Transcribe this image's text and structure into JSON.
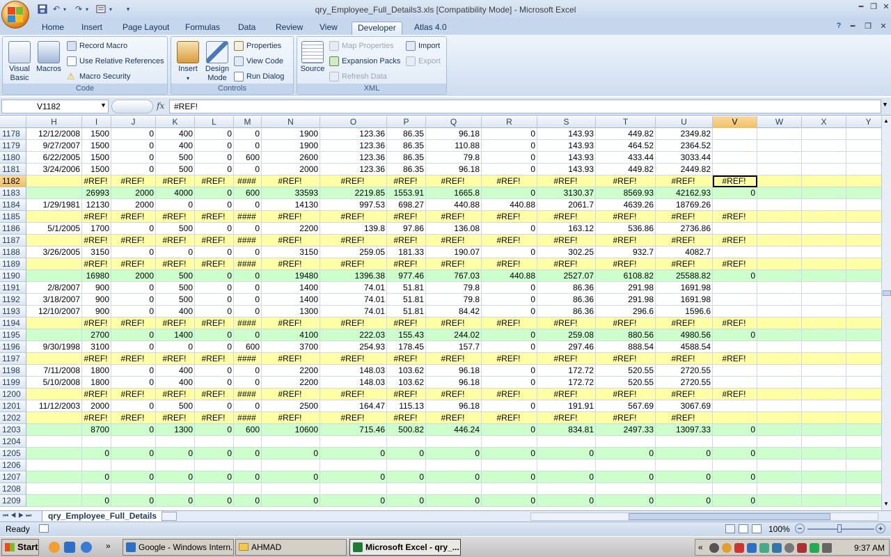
{
  "window": {
    "title": "qry_Employee_Full_Details3.xls  [Compatibility Mode] - Microsoft Excel"
  },
  "ribbon_tabs": [
    "Home",
    "Insert",
    "Page Layout",
    "Formulas",
    "Data",
    "Review",
    "View",
    "Developer",
    "Atlas 4.0"
  ],
  "active_tab": "Developer",
  "groups": {
    "code": {
      "title": "Code",
      "visual_basic": "Visual\nBasic",
      "macros": "Macros",
      "record_macro": "Record Macro",
      "relative_refs": "Use Relative References",
      "macro_security": "Macro Security"
    },
    "controls": {
      "title": "Controls",
      "insert": "Insert",
      "design_mode": "Design\nMode",
      "properties": "Properties",
      "view_code": "View Code",
      "run_dialog": "Run Dialog"
    },
    "xml": {
      "title": "XML",
      "source": "Source",
      "map_properties": "Map Properties",
      "expansion_packs": "Expansion Packs",
      "refresh_data": "Refresh Data",
      "import": "Import",
      "export": "Export"
    }
  },
  "formula_bar": {
    "name_box": "V1182",
    "fx": "fx",
    "formula": "#REF!"
  },
  "columns": [
    "H",
    "I",
    "J",
    "K",
    "L",
    "M",
    "N",
    "O",
    "P",
    "Q",
    "R",
    "S",
    "T",
    "U",
    "V",
    "W",
    "X",
    "Y"
  ],
  "selected_column": "V",
  "rows": [
    {
      "n": "1178",
      "style": "",
      "cells": [
        "12/12/2008",
        "1500",
        "0",
        "400",
        "0",
        "0",
        "1900",
        "123.36",
        "86.35",
        "96.18",
        "0",
        "143.93",
        "449.82",
        "2349.82",
        "",
        "",
        "",
        ""
      ]
    },
    {
      "n": "1179",
      "style": "",
      "cells": [
        "9/27/2007",
        "1500",
        "0",
        "400",
        "0",
        "0",
        "1900",
        "123.36",
        "86.35",
        "110.88",
        "0",
        "143.93",
        "464.52",
        "2364.52",
        "",
        "",
        "",
        ""
      ]
    },
    {
      "n": "1180",
      "style": "",
      "cells": [
        "6/22/2005",
        "1500",
        "0",
        "500",
        "0",
        "600",
        "2600",
        "123.36",
        "86.35",
        "79.8",
        "0",
        "143.93",
        "433.44",
        "3033.44",
        "",
        "",
        "",
        ""
      ]
    },
    {
      "n": "1181",
      "style": "",
      "cells": [
        "3/24/2006",
        "1500",
        "0",
        "500",
        "0",
        "0",
        "2000",
        "123.36",
        "86.35",
        "96.18",
        "0",
        "143.93",
        "449.82",
        "2449.82",
        "",
        "",
        "",
        ""
      ]
    },
    {
      "n": "1182",
      "style": "yel",
      "cells": [
        "",
        "#REF!",
        "#REF!",
        "#REF!",
        "#REF!",
        "####",
        "#REF!",
        "#REF!",
        "#REF!",
        "#REF!",
        "#REF!",
        "#REF!",
        "#REF!",
        "#REF!",
        "#REF!",
        "",
        "",
        ""
      ]
    },
    {
      "n": "1183",
      "style": "grn",
      "cells": [
        "",
        "26993",
        "2000",
        "4000",
        "0",
        "600",
        "33593",
        "2219.85",
        "1553.91",
        "1665.8",
        "0",
        "3130.37",
        "8569.93",
        "42162.93",
        "0",
        "",
        "",
        ""
      ]
    },
    {
      "n": "1184",
      "style": "",
      "cells": [
        "1/29/1981",
        "12130",
        "2000",
        "0",
        "0",
        "0",
        "14130",
        "997.53",
        "698.27",
        "440.88",
        "440.88",
        "2061.7",
        "4639.26",
        "18769.26",
        "",
        "",
        "",
        ""
      ]
    },
    {
      "n": "1185",
      "style": "yel",
      "cells": [
        "",
        "#REF!",
        "#REF!",
        "#REF!",
        "#REF!",
        "####",
        "#REF!",
        "#REF!",
        "#REF!",
        "#REF!",
        "#REF!",
        "#REF!",
        "#REF!",
        "#REF!",
        "#REF!",
        "",
        "",
        ""
      ]
    },
    {
      "n": "1186",
      "style": "",
      "cells": [
        "5/1/2005",
        "1700",
        "0",
        "500",
        "0",
        "0",
        "2200",
        "139.8",
        "97.86",
        "136.08",
        "0",
        "163.12",
        "536.86",
        "2736.86",
        "",
        "",
        "",
        ""
      ]
    },
    {
      "n": "1187",
      "style": "yel",
      "cells": [
        "",
        "#REF!",
        "#REF!",
        "#REF!",
        "#REF!",
        "####",
        "#REF!",
        "#REF!",
        "#REF!",
        "#REF!",
        "#REF!",
        "#REF!",
        "#REF!",
        "#REF!",
        "#REF!",
        "",
        "",
        ""
      ]
    },
    {
      "n": "1188",
      "style": "",
      "cells": [
        "3/26/2005",
        "3150",
        "0",
        "0",
        "0",
        "0",
        "3150",
        "259.05",
        "181.33",
        "190.07",
        "0",
        "302.25",
        "932.7",
        "4082.7",
        "",
        "",
        "",
        ""
      ]
    },
    {
      "n": "1189",
      "style": "yel",
      "cells": [
        "",
        "#REF!",
        "#REF!",
        "#REF!",
        "#REF!",
        "####",
        "#REF!",
        "#REF!",
        "#REF!",
        "#REF!",
        "#REF!",
        "#REF!",
        "#REF!",
        "#REF!",
        "#REF!",
        "",
        "",
        ""
      ]
    },
    {
      "n": "1190",
      "style": "grn",
      "cells": [
        "",
        "16980",
        "2000",
        "500",
        "0",
        "0",
        "19480",
        "1396.38",
        "977.46",
        "767.03",
        "440.88",
        "2527.07",
        "6108.82",
        "25588.82",
        "0",
        "",
        "",
        ""
      ]
    },
    {
      "n": "1191",
      "style": "",
      "cells": [
        "2/8/2007",
        "900",
        "0",
        "500",
        "0",
        "0",
        "1400",
        "74.01",
        "51.81",
        "79.8",
        "0",
        "86.36",
        "291.98",
        "1691.98",
        "",
        "",
        "",
        ""
      ]
    },
    {
      "n": "1192",
      "style": "",
      "cells": [
        "3/18/2007",
        "900",
        "0",
        "500",
        "0",
        "0",
        "1400",
        "74.01",
        "51.81",
        "79.8",
        "0",
        "86.36",
        "291.98",
        "1691.98",
        "",
        "",
        "",
        ""
      ]
    },
    {
      "n": "1193",
      "style": "",
      "cells": [
        "12/10/2007",
        "900",
        "0",
        "400",
        "0",
        "0",
        "1300",
        "74.01",
        "51.81",
        "84.42",
        "0",
        "86.36",
        "296.6",
        "1596.6",
        "",
        "",
        "",
        ""
      ]
    },
    {
      "n": "1194",
      "style": "yel",
      "cells": [
        "",
        "#REF!",
        "#REF!",
        "#REF!",
        "#REF!",
        "####",
        "#REF!",
        "#REF!",
        "#REF!",
        "#REF!",
        "#REF!",
        "#REF!",
        "#REF!",
        "#REF!",
        "#REF!",
        "",
        "",
        ""
      ]
    },
    {
      "n": "1195",
      "style": "grn",
      "cells": [
        "",
        "2700",
        "0",
        "1400",
        "0",
        "0",
        "4100",
        "222.03",
        "155.43",
        "244.02",
        "0",
        "259.08",
        "880.56",
        "4980.56",
        "0",
        "",
        "",
        ""
      ]
    },
    {
      "n": "1196",
      "style": "",
      "cells": [
        "9/30/1998",
        "3100",
        "0",
        "0",
        "0",
        "600",
        "3700",
        "254.93",
        "178.45",
        "157.7",
        "0",
        "297.46",
        "888.54",
        "4588.54",
        "",
        "",
        "",
        ""
      ]
    },
    {
      "n": "1197",
      "style": "yel",
      "cells": [
        "",
        "#REF!",
        "#REF!",
        "#REF!",
        "#REF!",
        "####",
        "#REF!",
        "#REF!",
        "#REF!",
        "#REF!",
        "#REF!",
        "#REF!",
        "#REF!",
        "#REF!",
        "#REF!",
        "",
        "",
        ""
      ]
    },
    {
      "n": "1198",
      "style": "",
      "cells": [
        "7/11/2008",
        "1800",
        "0",
        "400",
        "0",
        "0",
        "2200",
        "148.03",
        "103.62",
        "96.18",
        "0",
        "172.72",
        "520.55",
        "2720.55",
        "",
        "",
        "",
        ""
      ]
    },
    {
      "n": "1199",
      "style": "",
      "cells": [
        "5/10/2008",
        "1800",
        "0",
        "400",
        "0",
        "0",
        "2200",
        "148.03",
        "103.62",
        "96.18",
        "0",
        "172.72",
        "520.55",
        "2720.55",
        "",
        "",
        "",
        ""
      ]
    },
    {
      "n": "1200",
      "style": "yel",
      "cells": [
        "",
        "#REF!",
        "#REF!",
        "#REF!",
        "#REF!",
        "####",
        "#REF!",
        "#REF!",
        "#REF!",
        "#REF!",
        "#REF!",
        "#REF!",
        "#REF!",
        "#REF!",
        "#REF!",
        "",
        "",
        ""
      ]
    },
    {
      "n": "1201",
      "style": "",
      "cells": [
        "11/12/2003",
        "2000",
        "0",
        "500",
        "0",
        "0",
        "2500",
        "164.47",
        "115.13",
        "96.18",
        "0",
        "191.91",
        "567.69",
        "3067.69",
        "",
        "",
        "",
        ""
      ]
    },
    {
      "n": "1202",
      "style": "yel",
      "cells": [
        "",
        "#REF!",
        "#REF!",
        "#REF!",
        "#REF!",
        "####",
        "#REF!",
        "#REF!",
        "#REF!",
        "#REF!",
        "#REF!",
        "#REF!",
        "#REF!",
        "#REF!",
        "",
        "",
        "",
        ""
      ]
    },
    {
      "n": "1203",
      "style": "grn",
      "cells": [
        "",
        "8700",
        "0",
        "1300",
        "0",
        "600",
        "10600",
        "715.46",
        "500.82",
        "446.24",
        "0",
        "834.81",
        "2497.33",
        "13097.33",
        "0",
        "",
        "",
        ""
      ]
    },
    {
      "n": "1204",
      "style": "",
      "cells": [
        "",
        "",
        "",
        "",
        "",
        "",
        "",
        "",
        "",
        "",
        "",
        "",
        "",
        "",
        "",
        "",
        "",
        ""
      ]
    },
    {
      "n": "1205",
      "style": "grn",
      "cells": [
        "",
        "0",
        "0",
        "0",
        "0",
        "0",
        "0",
        "0",
        "0",
        "0",
        "0",
        "0",
        "0",
        "0",
        "0",
        "",
        "",
        ""
      ]
    },
    {
      "n": "1206",
      "style": "",
      "cells": [
        "",
        "",
        "",
        "",
        "",
        "",
        "",
        "",
        "",
        "",
        "",
        "",
        "",
        "",
        "",
        "",
        "",
        ""
      ]
    },
    {
      "n": "1207",
      "style": "grn",
      "cells": [
        "",
        "0",
        "0",
        "0",
        "0",
        "0",
        "0",
        "0",
        "0",
        "0",
        "0",
        "0",
        "0",
        "0",
        "0",
        "",
        "",
        ""
      ]
    },
    {
      "n": "1208",
      "style": "",
      "cells": [
        "",
        "",
        "",
        "",
        "",
        "",
        "",
        "",
        "",
        "",
        "",
        "",
        "",
        "",
        "",
        "",
        "",
        ""
      ]
    },
    {
      "n": "1209",
      "style": "grn",
      "cells": [
        "",
        "0",
        "0",
        "0",
        "0",
        "0",
        "0",
        "0",
        "0",
        "0",
        "0",
        "0",
        "0",
        "0",
        "0",
        "",
        "",
        ""
      ]
    }
  ],
  "active_cell": {
    "row": "1182",
    "col": "V"
  },
  "sheet_tab": "qry_Employee_Full_Details",
  "status": {
    "ready": "Ready",
    "zoom": "100%"
  },
  "taskbar": {
    "start": "Start",
    "items": [
      "Google - Windows Intern...",
      "AHMAD",
      "Microsoft Excel - qry_..."
    ],
    "active_index": 2,
    "clock": "9:37 AM"
  },
  "colors": {
    "yellow_row": "#ffffa6",
    "green_row": "#ccffcc",
    "ribbon": "#dbe7f5"
  }
}
